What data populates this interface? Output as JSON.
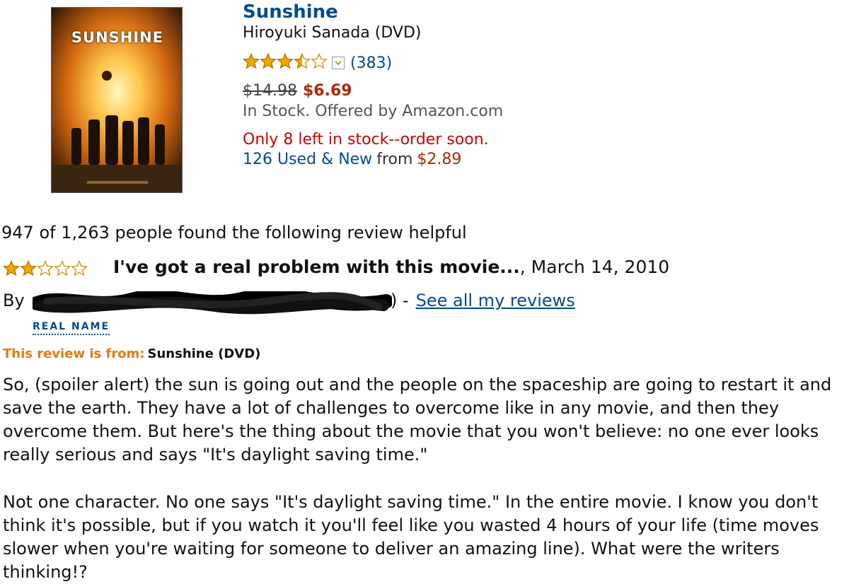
{
  "product": {
    "cover_title": "SUNSHINE",
    "title": "Sunshine",
    "subtitle": "Hiroyuki Sanada (DVD)",
    "rating_stars": 3.5,
    "rating_count": "(383)",
    "list_price": "$14.98",
    "sale_price": "$6.69",
    "stock": "In Stock.  Offered by Amazon.com",
    "low_stock": "Only 8 left in stock--order soon.",
    "used_new_link": "126 Used & New",
    "used_new_from": "from",
    "used_new_price": "$2.89"
  },
  "review": {
    "helpful": "947 of 1,263 people found the following review helpful",
    "rating_stars": 2,
    "title": "I've got a real problem with this movie...",
    "date": ", March 14, 2010",
    "by": "By",
    "by_suffix": ") -",
    "see_all": "See all my reviews",
    "real_name": "REAL NAME",
    "from_label": "This review is from:",
    "from_value": "Sunshine (DVD)",
    "paragraphs": [
      "So, (spoiler alert) the sun is going out and the people on the spaceship are going to restart it and save the earth. They have a lot of challenges to overcome like in any movie, and then they overcome them. But here's the thing about the movie that you won't believe: no one ever looks really serious and says \"It's daylight saving time.\"",
      "Not one character. No one says \"It's daylight saving time.\" In the entire movie. I know you don't think it's possible, but if you watch it you'll feel like you wasted 4 hours of your life (time moves slower when you're waiting for someone to deliver an amazing line). What were the writers thinking!?"
    ]
  },
  "colors": {
    "link": "#004b91",
    "price": "#b12704",
    "warning": "#cc0000",
    "label_orange": "#e47911",
    "star_fill": "#f0a800"
  }
}
